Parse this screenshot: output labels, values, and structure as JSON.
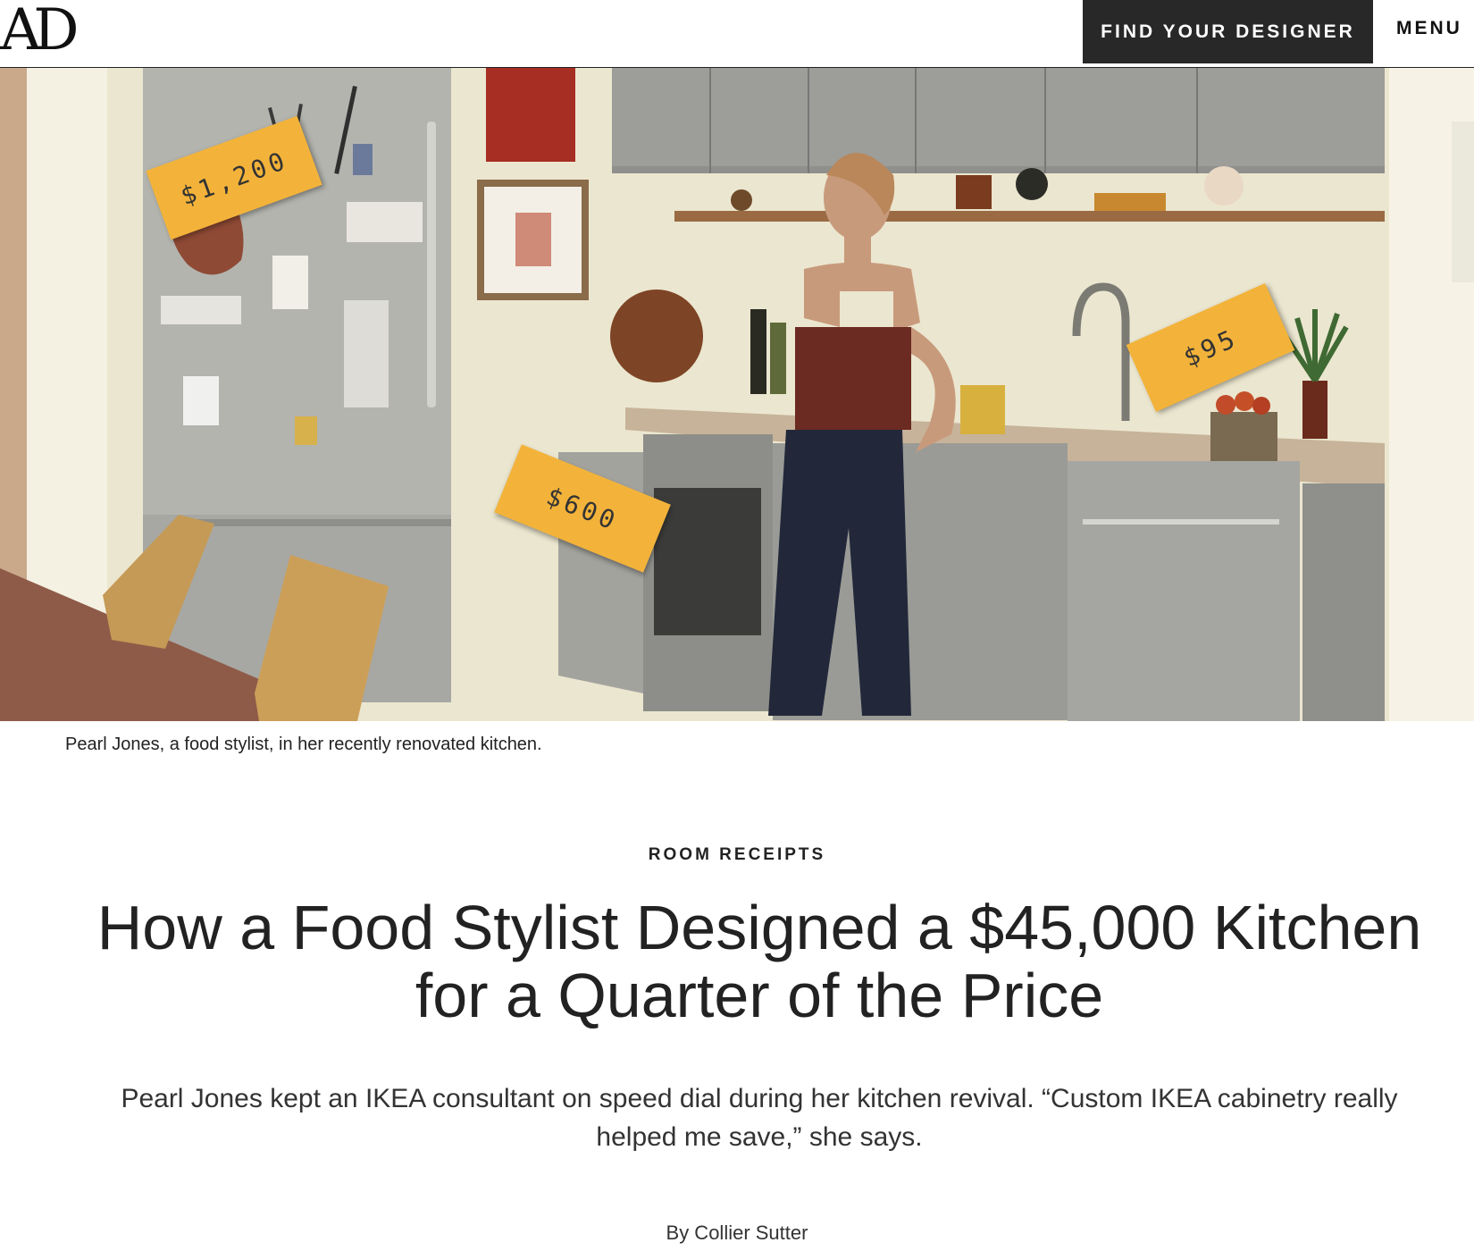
{
  "header": {
    "logo": "AD",
    "find_designer_label": "FIND YOUR DESIGNER",
    "menu_label": "MENU"
  },
  "hero": {
    "price_tags": [
      "$1,200",
      "$600",
      "$95"
    ],
    "caption": "Pearl Jones, a food stylist, in her recently renovated kitchen."
  },
  "article": {
    "rubric": "ROOM RECEIPTS",
    "headline": "How a Food Stylist Designed a $45,000 Kitchen for a Quarter of the Price",
    "dek": "Pearl Jones kept an IKEA consultant on speed dial during her kitchen revival. “Custom IKEA cabinetry really helped me save,” she says.",
    "byline": "By Collier Sutter"
  },
  "colors": {
    "tag": "#f3b33a",
    "button_bg": "#282828"
  }
}
